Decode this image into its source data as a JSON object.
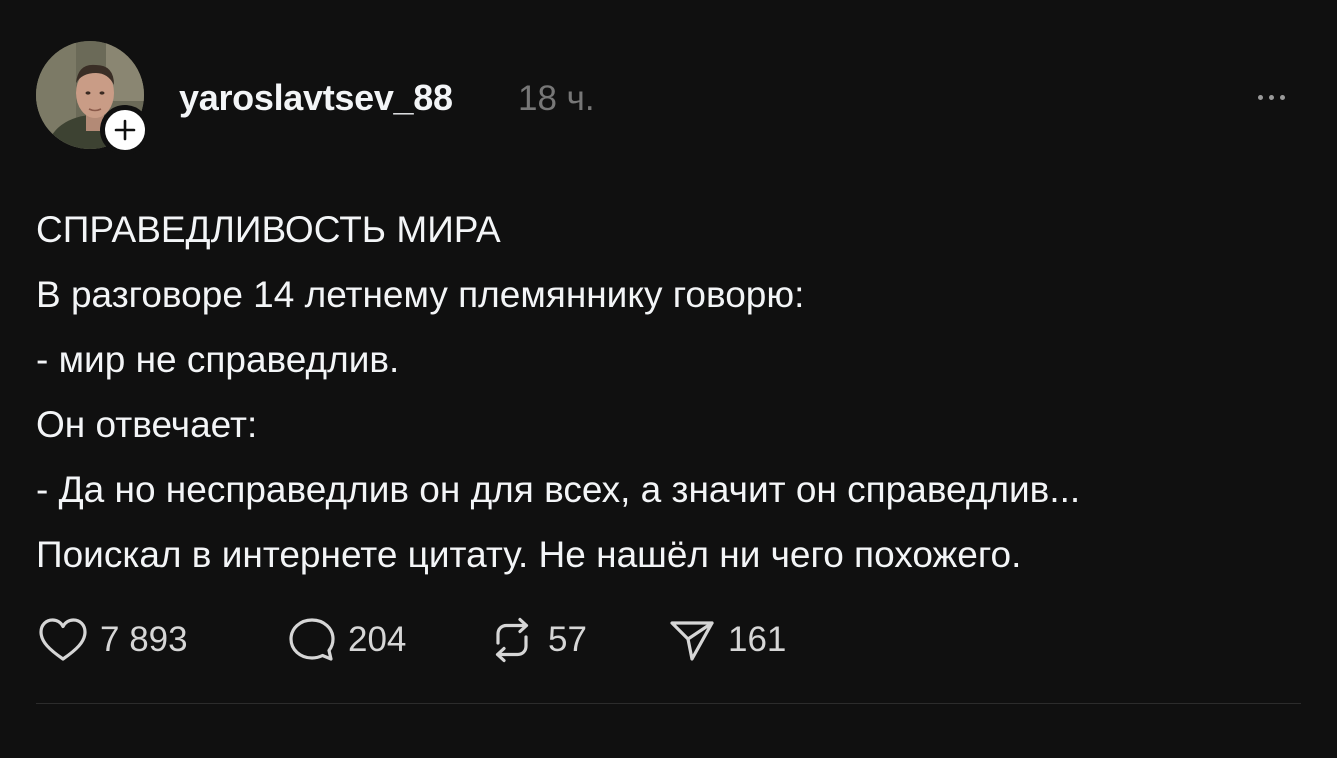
{
  "post": {
    "author": {
      "username": "yaroslavtsev_88",
      "avatar_icon": "user-avatar-photo",
      "follow_icon": "plus-icon"
    },
    "timestamp": "18 ч.",
    "more_icon": "more-horizontal-icon",
    "text_lines": [
      "СПРАВЕДЛИВОСТЬ МИРА",
      "В разговоре 14 летнему племяннику говорю:",
      "- мир не справедлив.",
      "Он отвечает:",
      "- Да но несправедлив он для всех, а значит он справедлив...",
      "Поискал в интернете цитату. Не нашёл ни чего похожего."
    ],
    "actions": {
      "likes": "7 893",
      "comments": "204",
      "reposts": "57",
      "shares": "161"
    }
  },
  "colors": {
    "background": "#101010",
    "text": "#f3f5f7",
    "muted": "#777777",
    "divider": "#2c2c2c"
  }
}
